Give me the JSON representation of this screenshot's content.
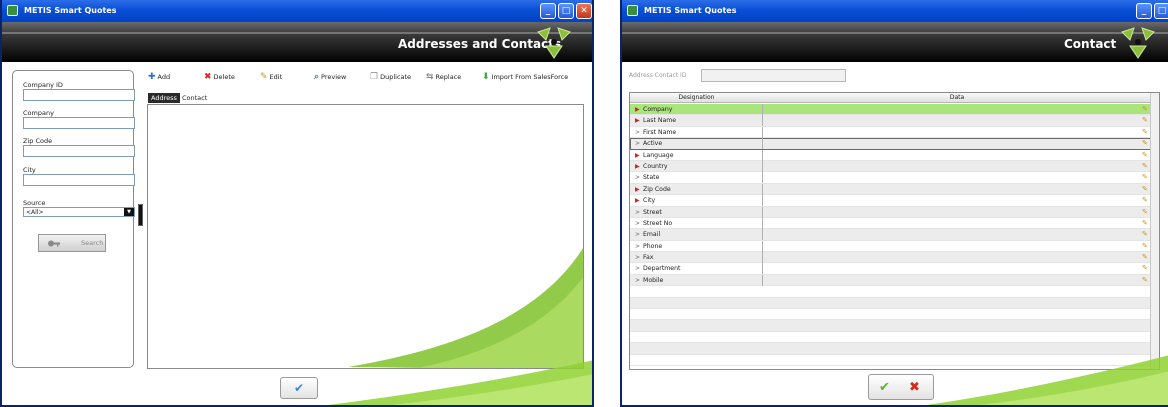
{
  "left_window": {
    "title": "METIS Smart Quotes",
    "header_title": "Addresses and Contacts",
    "title_buttons": {
      "minimize": "_",
      "maximize": "□",
      "close": "✕"
    },
    "search_panel": {
      "fields": [
        {
          "label": "Company ID",
          "value": ""
        },
        {
          "label": "Company",
          "value": ""
        },
        {
          "label": "Zip Code",
          "value": ""
        },
        {
          "label": "City",
          "value": ""
        }
      ],
      "source_label": "Source",
      "source_value": "<All>",
      "search_button": "Search"
    },
    "toolbar": {
      "add": "Add",
      "delete": "Delete",
      "edit": "Edit",
      "preview": "Preview",
      "duplicate": "Duplicate",
      "replace": "Replace",
      "import": "Import From SalesForce"
    },
    "tabs": [
      {
        "label": "Address",
        "active": true
      },
      {
        "label": "Contact",
        "active": false
      }
    ],
    "ok_button_icon": "checkmark-icon"
  },
  "right_window": {
    "title": "METIS Smart Quotes",
    "header_title": "Contact",
    "address_contact_id_label": "Address Contact ID",
    "address_contact_id_value": "",
    "grid": {
      "columns": [
        "Designation",
        "Data"
      ],
      "rows": [
        {
          "designation": "Company",
          "data": "",
          "required": true,
          "selected": true
        },
        {
          "designation": "Last Name",
          "data": "",
          "required": true
        },
        {
          "designation": "First Name",
          "data": "",
          "required": false
        },
        {
          "designation": "Active",
          "data": "",
          "required": false,
          "focused": true
        },
        {
          "designation": "Language",
          "data": "",
          "required": true
        },
        {
          "designation": "Country",
          "data": "",
          "required": true
        },
        {
          "designation": "State",
          "data": "",
          "required": false
        },
        {
          "designation": "Zip Code",
          "data": "",
          "required": true
        },
        {
          "designation": "City",
          "data": "",
          "required": true
        },
        {
          "designation": "Street",
          "data": "",
          "required": false
        },
        {
          "designation": "Street No",
          "data": "",
          "required": false
        },
        {
          "designation": "Email",
          "data": "",
          "required": false
        },
        {
          "designation": "Phone",
          "data": "",
          "required": false
        },
        {
          "designation": "Fax",
          "data": "",
          "required": false
        },
        {
          "designation": "Department",
          "data": "",
          "required": false
        },
        {
          "designation": "Mobile",
          "data": "",
          "required": false
        }
      ]
    },
    "ok_button_icon": "checkmark-icon",
    "cancel_button_icon": "cancel-x-icon"
  },
  "colors": {
    "titlebar": "#0a4fd6",
    "header_band": "#1a1a1a",
    "selected_row": "#a9e57a",
    "required_arrow": "#c9271e",
    "swoosh_green": "#7fc22a"
  }
}
